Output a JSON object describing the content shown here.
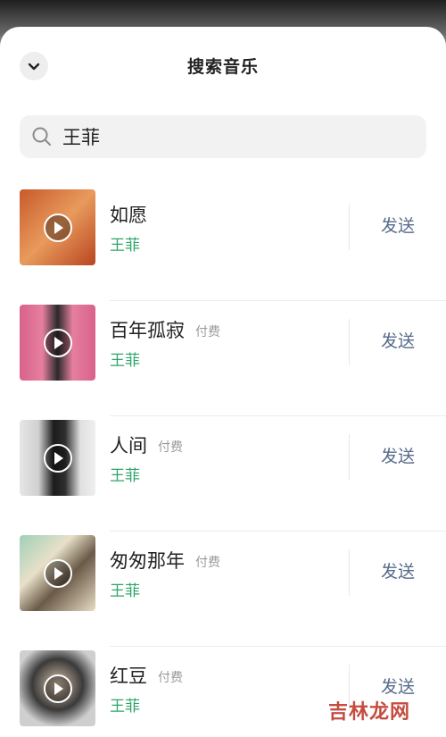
{
  "header": {
    "title": "搜索音乐"
  },
  "search": {
    "value": "王菲"
  },
  "songs": [
    {
      "title": "如愿",
      "paid": "",
      "artist": "王菲",
      "action": "发送",
      "cover_colors": [
        "#c85a2c",
        "#e89a5c"
      ]
    },
    {
      "title": "百年孤寂",
      "paid": "付费",
      "artist": "王菲",
      "action": "发送",
      "cover_colors": [
        "#d9628a",
        "#2a2a2a"
      ]
    },
    {
      "title": "人间",
      "paid": "付费",
      "artist": "王菲",
      "action": "发送",
      "cover_colors": [
        "#dcdcdc",
        "#1c1c1c"
      ]
    },
    {
      "title": "匆匆那年",
      "paid": "付费",
      "artist": "王菲",
      "action": "发送",
      "cover_colors": [
        "#e8e0c8",
        "#6a5a48"
      ]
    },
    {
      "title": "红豆",
      "paid": "付费",
      "artist": "王菲",
      "action": "发送",
      "cover_colors": [
        "#cfcfcf",
        "#3a3a3a"
      ]
    }
  ],
  "watermark": "吉林龙网",
  "colors": {
    "artist": "#2ea56a",
    "send": "#586b8a",
    "paid": "#9a9a9a"
  }
}
